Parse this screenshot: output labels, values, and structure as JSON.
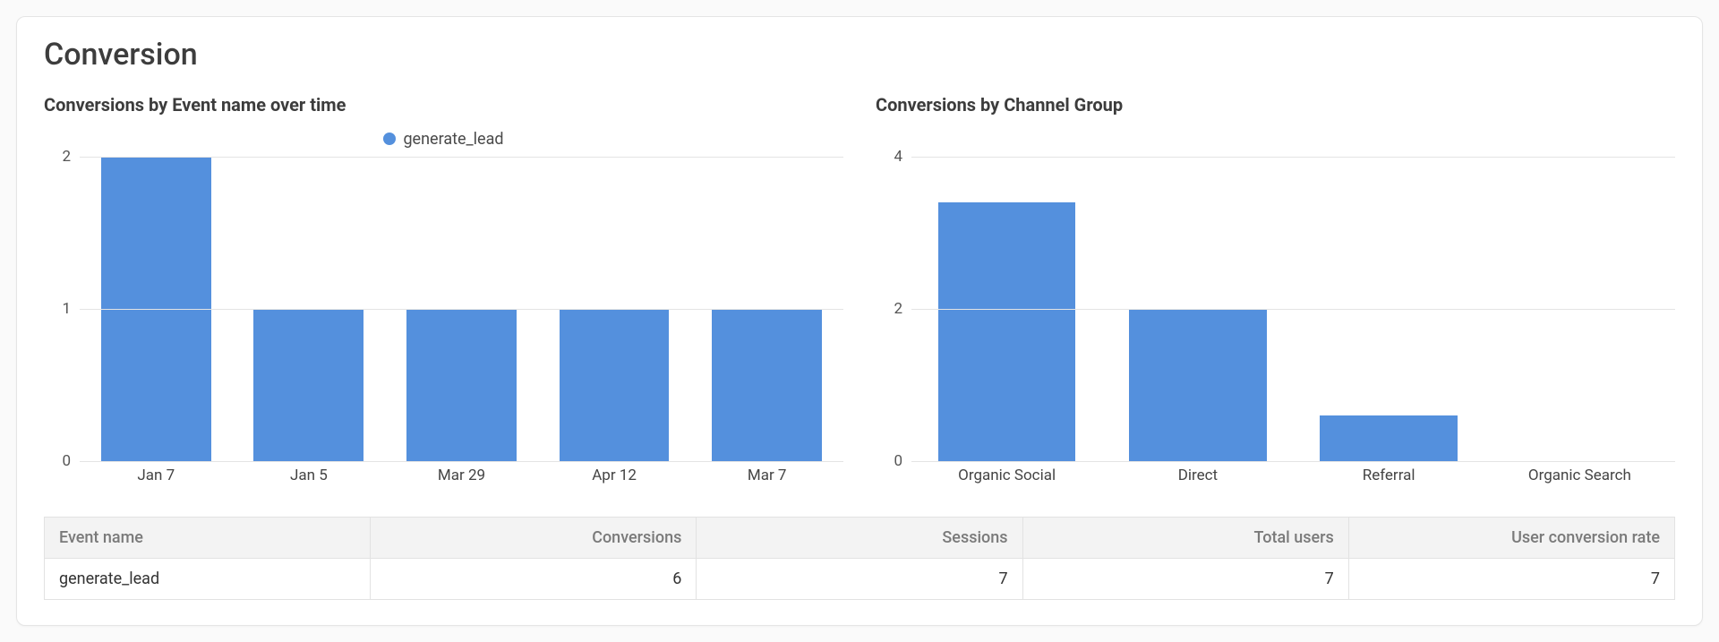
{
  "card": {
    "title": "Conversion"
  },
  "chart1": {
    "title": "Conversions by Event name over time",
    "legend_label": "generate_lead"
  },
  "chart2": {
    "title": "Conversions by Channel Group"
  },
  "table": {
    "headers": {
      "event_name": "Event name",
      "conversions": "Conversions",
      "sessions": "Sessions",
      "total_users": "Total users",
      "ucr": "User conversion rate"
    },
    "row": {
      "event_name": "generate_lead",
      "conversions": "6",
      "sessions": "7",
      "total_users": "7",
      "ucr": "7"
    }
  },
  "chart_data": [
    {
      "type": "bar",
      "title": "Conversions by Event name over time",
      "legend": [
        "generate_lead"
      ],
      "categories": [
        "Jan 7",
        "Jan 5",
        "Mar 29",
        "Apr 12",
        "Mar 7"
      ],
      "values": [
        2,
        1,
        1,
        1,
        1
      ],
      "ylim": [
        0,
        2
      ],
      "yticks": [
        0,
        1,
        2
      ],
      "xlabel": "",
      "ylabel": ""
    },
    {
      "type": "bar",
      "title": "Conversions by Channel Group",
      "categories": [
        "Organic Social",
        "Direct",
        "Referral",
        "Organic Search"
      ],
      "values": [
        3.4,
        2,
        0.6,
        0
      ],
      "ylim": [
        0,
        4
      ],
      "yticks": [
        0,
        2,
        4
      ],
      "xlabel": "",
      "ylabel": ""
    }
  ]
}
